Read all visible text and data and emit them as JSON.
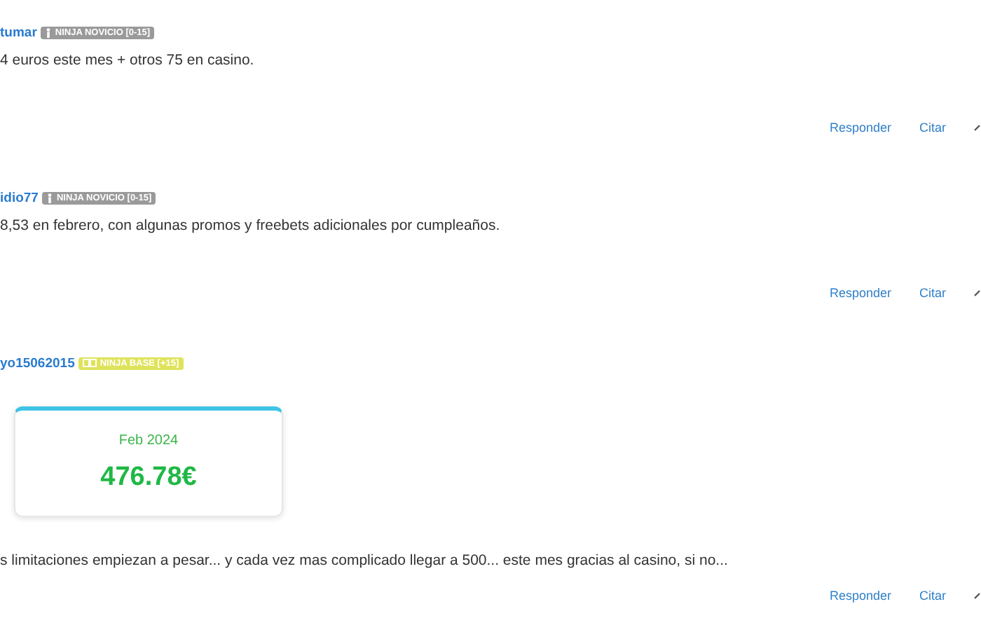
{
  "posts": [
    {
      "author": "tumar",
      "badge": {
        "kind": "novice",
        "label": "NINJA NOVICIO [0-15]"
      },
      "text": "4 euros este mes + otros 75 en casino.",
      "actions": [
        "Responder",
        "Citar"
      ]
    },
    {
      "author": "idio77",
      "badge": {
        "kind": "novice",
        "label": "NINJA NOVICIO [0-15]"
      },
      "text": "8,53 en febrero, con algunas promos y freebets adicionales por cumpleaños.",
      "actions": [
        "Responder",
        "Citar"
      ]
    },
    {
      "author": "yo15062015",
      "badge": {
        "kind": "base",
        "label": "NINJA BASE [+15]"
      },
      "card": {
        "period": "Feb 2024",
        "amount": "476.78€"
      },
      "text": "s limitaciones empiezan a pesar... y cada vez mas complicado llegar a 500... este mes gracias al casino, si no...",
      "actions": [
        "Responder",
        "Citar"
      ]
    }
  ]
}
